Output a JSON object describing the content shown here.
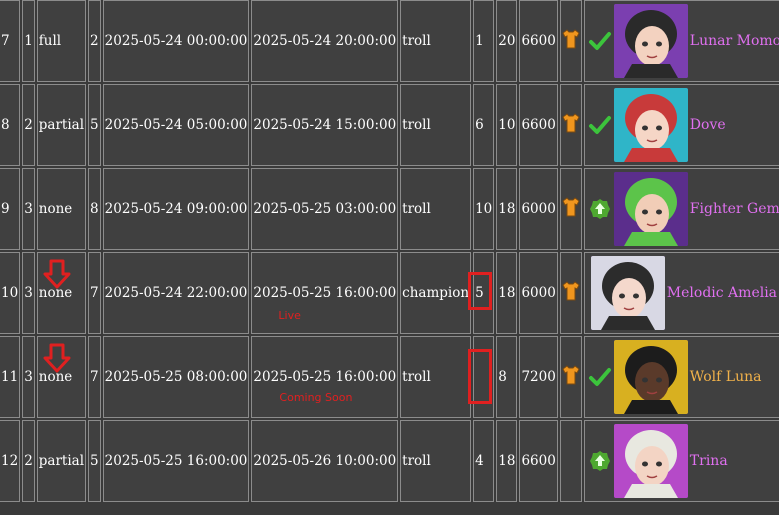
{
  "colors": {
    "background": "#3a3a3a",
    "cell": "#404040",
    "border": "#8c8c8c",
    "girl_name_pink": "#e070f0",
    "girl_name_orange": "#f2b24a",
    "highlight_red": "#e02020",
    "check_green": "#3cc43c",
    "shirt_orange": "#f0961e"
  },
  "rows": [
    {
      "idx": "7",
      "tier": "1",
      "mode": "full",
      "n": "2",
      "start": "2025-05-24 00:00:00",
      "end": "2025-05-24 20:00:00",
      "type": "troll",
      "a": "1",
      "b": "20",
      "pts": "6600",
      "shirt": "shirt-icon",
      "mark": "check",
      "name": "Lunar Momoko",
      "name_color": "pink",
      "status": "",
      "flag": ""
    },
    {
      "idx": "8",
      "tier": "2",
      "mode": "partial",
      "n": "5",
      "start": "2025-05-24 05:00:00",
      "end": "2025-05-24 15:00:00",
      "type": "troll",
      "a": "6",
      "b": "10",
      "pts": "6600",
      "shirt": "shirt-icon",
      "mark": "check",
      "name": "Dove",
      "name_color": "pink",
      "status": "",
      "flag": ""
    },
    {
      "idx": "9",
      "tier": "3",
      "mode": "none",
      "n": "8",
      "start": "2025-05-24 09:00:00",
      "end": "2025-05-25 03:00:00",
      "type": "troll",
      "a": "10",
      "b": "18",
      "pts": "6000",
      "shirt": "shirt-icon",
      "mark": "upgrade",
      "name": "Fighter Gemini",
      "name_color": "pink",
      "status": "",
      "flag": ""
    },
    {
      "idx": "10",
      "tier": "3",
      "mode": "none",
      "n": "7",
      "start": "2025-05-24 22:00:00",
      "end": "2025-05-25 16:00:00",
      "type": "champion",
      "a": "5",
      "b": "18",
      "pts": "6000",
      "shirt": "shirt-icon",
      "mark": "",
      "name": "Melodic Amelia",
      "name_color": "pink",
      "status": "Live",
      "flag": "arrow"
    },
    {
      "idx": "11",
      "tier": "3",
      "mode": "none",
      "n": "7",
      "start": "2025-05-25 08:00:00",
      "end": "2025-05-25 16:00:00",
      "type": "troll",
      "a": "",
      "b": "8",
      "pts": "7200",
      "shirt": "shirt-icon",
      "mark": "check",
      "name": "Wolf Luna",
      "name_color": "orange",
      "status": "Coming Soon",
      "flag": "arrow"
    },
    {
      "idx": "12",
      "tier": "2",
      "mode": "partial",
      "n": "5",
      "start": "2025-05-25 16:00:00",
      "end": "2025-05-26 10:00:00",
      "type": "troll",
      "a": "4",
      "b": "18",
      "pts": "6600",
      "shirt": "",
      "mark": "upgrade",
      "name": "Trina",
      "name_color": "pink",
      "status": "",
      "flag": ""
    }
  ]
}
